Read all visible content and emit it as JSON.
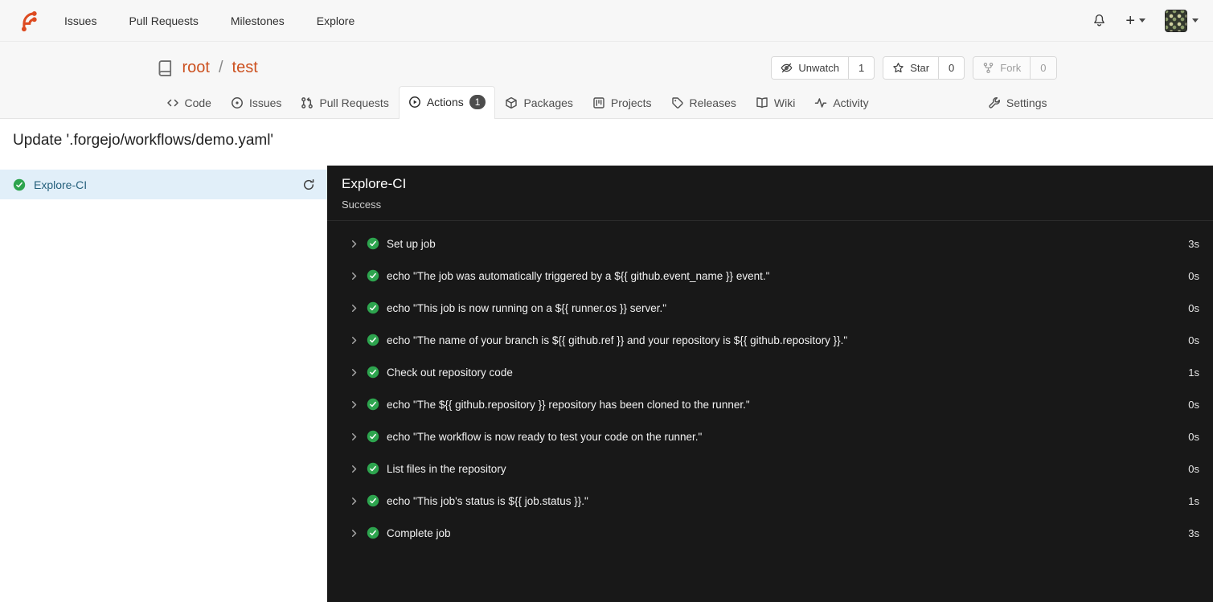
{
  "navbar": {
    "items": [
      {
        "label": "Issues"
      },
      {
        "label": "Pull Requests"
      },
      {
        "label": "Milestones"
      },
      {
        "label": "Explore"
      }
    ],
    "create_label": "+"
  },
  "repo": {
    "owner": "root",
    "separator": "/",
    "name": "test",
    "actions": {
      "unwatch": {
        "label": "Unwatch",
        "count": "1"
      },
      "star": {
        "label": "Star",
        "count": "0"
      },
      "fork": {
        "label": "Fork",
        "count": "0"
      }
    },
    "tabs": [
      {
        "label": "Code"
      },
      {
        "label": "Issues"
      },
      {
        "label": "Pull Requests"
      },
      {
        "label": "Actions",
        "badge": "1"
      },
      {
        "label": "Packages"
      },
      {
        "label": "Projects"
      },
      {
        "label": "Releases"
      },
      {
        "label": "Wiki"
      },
      {
        "label": "Activity"
      },
      {
        "label": "Settings"
      }
    ]
  },
  "run": {
    "title": "Update '.forgejo/workflows/demo.yaml'",
    "jobs": [
      {
        "name": "Explore-CI",
        "status": "success"
      }
    ],
    "job_detail": {
      "name": "Explore-CI",
      "status_text": "Success"
    },
    "steps": [
      {
        "name": "Set up job",
        "duration": "3s"
      },
      {
        "name": "echo \"The job was automatically triggered by a ${{ github.event_name }} event.\"",
        "duration": "0s"
      },
      {
        "name": "echo \"This job is now running on a ${{ runner.os }} server.\"",
        "duration": "0s"
      },
      {
        "name": "echo \"The name of your branch is ${{ github.ref }} and your repository is ${{ github.repository }}.\"",
        "duration": "0s"
      },
      {
        "name": "Check out repository code",
        "duration": "1s"
      },
      {
        "name": "echo \"The ${{ github.repository }} repository has been cloned to the runner.\"",
        "duration": "0s"
      },
      {
        "name": "echo \"The workflow is now ready to test your code on the runner.\"",
        "duration": "0s"
      },
      {
        "name": "List files in the repository",
        "duration": "0s"
      },
      {
        "name": "echo \"This job's status is ${{ job.status }}.\"",
        "duration": "1s"
      },
      {
        "name": "Complete job",
        "duration": "3s"
      }
    ]
  },
  "colors": {
    "accent_orange": "#cc5120",
    "success_green": "#2da44e",
    "selected_job_bg": "#e1eff9",
    "log_panel_bg": "#181818",
    "topbar_bg": "#f7f7f7"
  }
}
